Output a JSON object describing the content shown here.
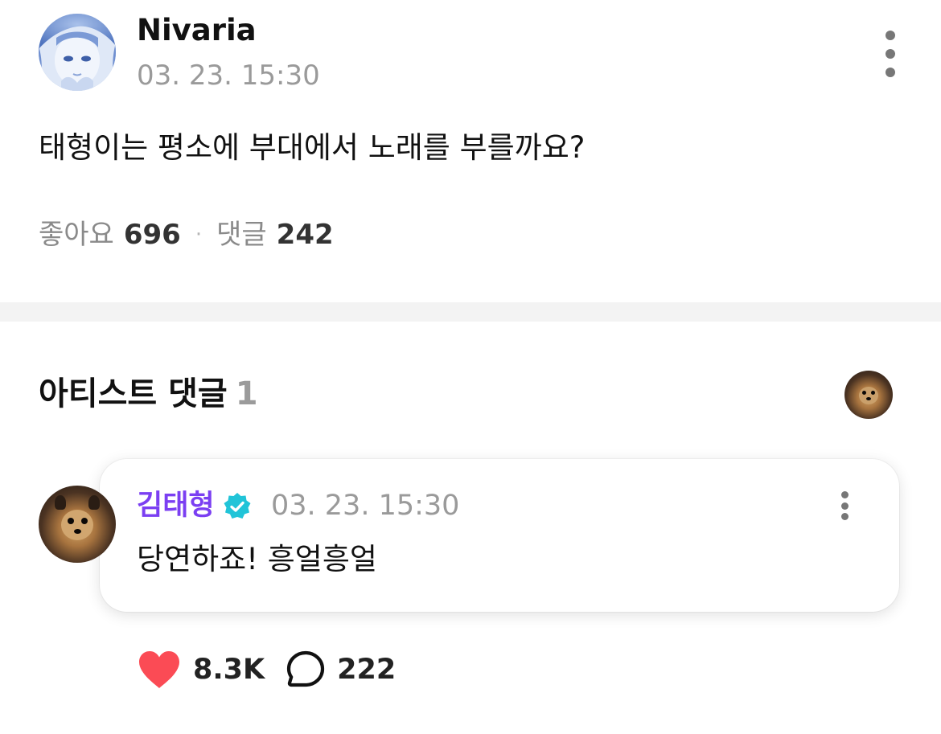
{
  "post": {
    "author_name": "Nivaria",
    "timestamp": "03. 23. 15:30",
    "body": "태형이는 평소에 부대에서 노래를 부를까요?",
    "likes_label": "좋아요",
    "likes_count": "696",
    "separator": "·",
    "comments_label": "댓글",
    "comments_count": "242",
    "more_icon": "more-vertical-icon"
  },
  "artist_comments": {
    "title": "아티스트 댓글",
    "count": "1",
    "comment": {
      "author_name": "김태형",
      "verified_icon": "verified-badge-icon",
      "timestamp": "03. 23. 15:30",
      "text": "당연하죠! 흥얼흥얼",
      "like_icon": "heart-icon",
      "likes": "8.3K",
      "reply_icon": "speech-bubble-icon",
      "replies": "222",
      "more_icon": "more-vertical-icon"
    }
  },
  "colors": {
    "artist_name": "#7b3ff2",
    "verified_badge": "#21c4d8",
    "heart": "#fb4b55",
    "muted_text": "#9a9a9a",
    "divider": "#f3f3f3"
  }
}
